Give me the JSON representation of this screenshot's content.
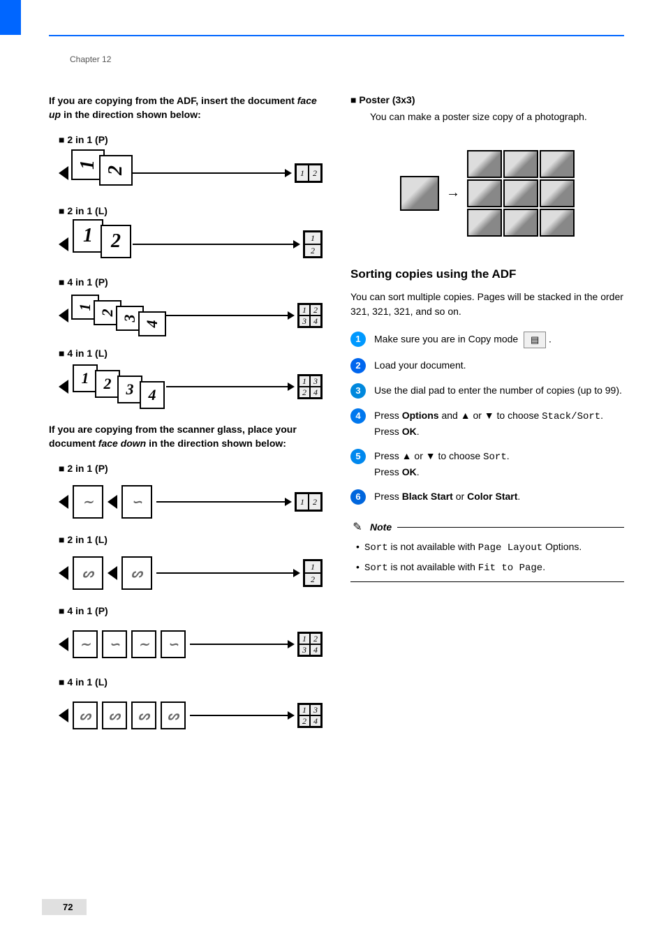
{
  "chapter": "Chapter 12",
  "page_number": "72",
  "left": {
    "intro_adf_pre": "If you are copying from the ADF, insert the document ",
    "intro_adf_em": "face up",
    "intro_adf_post": " in the direction shown below:",
    "layouts_adf": [
      "2 in 1 (P)",
      "2 in 1 (L)",
      "4 in 1 (P)",
      "4 in 1 (L)"
    ],
    "intro_glass_pre": "If you are copying from the scanner glass, place your document ",
    "intro_glass_em": "face down",
    "intro_glass_post": " in the direction shown below:",
    "layouts_glass": [
      "2 in 1 (P)",
      "2 in 1 (L)",
      "4 in 1 (P)",
      "4 in 1 (L)"
    ]
  },
  "right": {
    "poster_label": "Poster (3x3)",
    "poster_desc": "You can make a poster size copy of a photograph.",
    "sort_heading": "Sorting copies using the ADF",
    "sort_intro": "You can sort multiple copies. Pages will be stacked in the order 321, 321, 321, and so on.",
    "steps": {
      "s1": "Make sure you are in Copy mode",
      "s2": "Load your document.",
      "s3": "Use the dial pad to enter the number of copies (up to 99).",
      "s4_pre": "Press ",
      "s4_b1": "Options",
      "s4_mid": " and ▲ or ▼ to choose ",
      "s4_mono": "Stack/Sort",
      "s4_post": ".",
      "s4_line2_pre": "Press ",
      "s4_line2_b": "OK",
      "s4_line2_post": ".",
      "s5_pre": "Press ▲ or ▼ to choose ",
      "s5_mono": "Sort",
      "s5_post": ".",
      "s5_line2_pre": "Press ",
      "s5_line2_b": "OK",
      "s5_line2_post": ".",
      "s6_pre": "Press ",
      "s6_b1": "Black Start",
      "s6_mid": " or ",
      "s6_b2": "Color Start",
      "s6_post": "."
    },
    "note_title": "Note",
    "note_items": {
      "n1_mono1": "Sort",
      "n1_mid": " is not available with ",
      "n1_mono2": "Page Layout",
      "n1_post": " Options.",
      "n2_mono1": "Sort",
      "n2_mid": " is not available with ",
      "n2_mono2": "Fit to Page",
      "n2_post": "."
    }
  }
}
